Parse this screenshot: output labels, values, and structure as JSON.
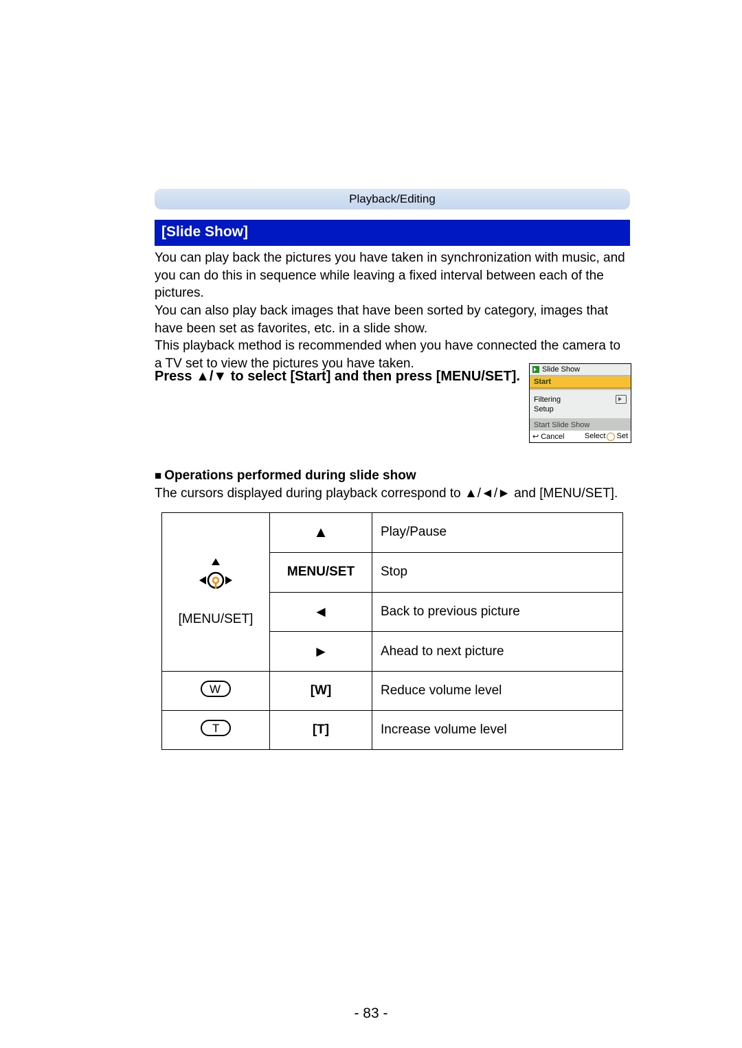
{
  "breadcrumb": "Playback/Editing",
  "section_title": "[Slide Show]",
  "paragraph1": "You can play back the pictures you have taken in synchronization with music, and you can do this in sequence while leaving a fixed interval between each of the pictures.",
  "paragraph2": "You can also play back images that have been sorted by category, images that have been set as favorites, etc. in a slide show.",
  "paragraph3": "This playback method is recommended when you have connected the camera to a TV set to view the pictures you have taken.",
  "instruction_pre": "Press ",
  "instruction_arrows": "▲/▼",
  "instruction_post": " to select [Start] and then press [MENU/SET].",
  "screen": {
    "title": "Slide Show",
    "start": "Start",
    "filtering": "Filtering",
    "setup": "Setup",
    "startshow": "Start Slide Show",
    "cancel": "Cancel",
    "select": "Select",
    "set": "Set"
  },
  "ops_header": "Operations performed during slide show",
  "ops_intro_pre": "The cursors displayed during playback correspond to ",
  "ops_intro_arrows": "▲/◄/►",
  "ops_intro_post": " and [MENU/SET].",
  "menuset_label": "[MENU/SET]",
  "table": {
    "r1": {
      "key": "▲",
      "desc": "Play/Pause"
    },
    "r2": {
      "key": "MENU/SET",
      "desc": "Stop"
    },
    "r3": {
      "key": "◄",
      "desc": "Back to previous picture"
    },
    "r4": {
      "key": "►",
      "desc": "Ahead to next picture"
    },
    "r5": {
      "key": "[W]",
      "desc": "Reduce volume level"
    },
    "r6": {
      "key": "[T]",
      "desc": "Increase volume level"
    },
    "w": "W",
    "t": "T"
  },
  "page_number": "- 83 -"
}
